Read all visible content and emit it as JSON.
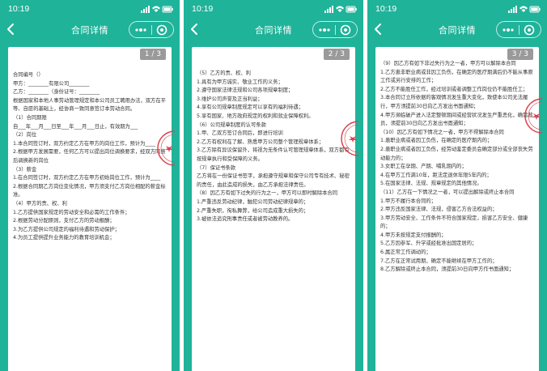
{
  "status": {
    "time": "10:19"
  },
  "nav": {
    "title": "合同详情"
  },
  "pages": [
    {
      "pager": "1 / 3",
      "lines": [
        "合同编号（）",
        "甲方：________有限公司________",
        "乙方：________（身份证号：________",
        "根据国家和本地人事劳动管理规定和本公司员工聘用办法，双方在平等、自愿的基础上，经协商一致同意签订本劳动合同。",
        "（1）合同期限",
        "自___年___月___日至___年___月___日止，有效期为___",
        "（2）岗位",
        "1.本合同签订时，双方约定乙方在甲方的岗位工作，预计为____",
        "2.根据甲方发展需要，任何乙方可以提出岗位调换要求，经双方同意后调换新的岗位",
        "（3）薪金",
        "1.在合同签订时，双方约定乙方在甲方初始岗位工作，预计为____",
        "2.根据合同期乙方岗位变化情况，甲方须支付乙方岗位相配的薪金标准。",
        "（4）甲方的责、权、利",
        "1.乙方提供国家规定的劳动安全和必需的工作条件；",
        "2.根据劳动分配原则，支付乙方的劳动报酬；",
        "3.为乙方提供公司规定的福利待遇和劳动保护；",
        "4.为员工提供提升业务能力的教育培训机会；"
      ]
    },
    {
      "pager": "2 / 3",
      "lines": [
        "（5）乙方的责、权、利",
        "1.具有为甲方诚实、敬业工作的义务；",
        "2.遵守国家法律法规和公司各项规章制度；",
        "3.维护公司声誉及正当利益；",
        "4.享有公司规章制度规定可以享有的福利待遇；",
        "5.享有国家、地方政府规定的权利和就业保障权利。",
        "（6）公司规章制度的认可条款",
        "1.甲、乙双方签订合同后，即进行培训",
        "2.乙方有权利在了解、熟悉甲方公司整个管理规章体系；",
        "3.乙方除有异议保留外，将视为无条件认可管理规章体系，双方都有按规章执行和受保障的义务。",
        "（7）保证书条款",
        "乙方将在一份保证书签字，承担遵守规章和保守公司专有技术、秘密的责任，由此造成的损失，由乙方承担法律责任。",
        "（8）因乙方有如下过失的行为之一，甲方可以即时解除本合同",
        "1.严重违反劳动纪律，触犯公司劳动纪律规章的；",
        "2.严重失职，徇私舞弊，给公司造成重大损失的；",
        "3.被依法追究刑事责任或者被劳动教养的。"
      ]
    },
    {
      "pager": "3 / 3",
      "lines": [
        "（9）因乙方有如下非过失行为之一者，甲方可以解除本合同",
        "1.乙方患非职业病或非因工负伤，在确定的医疗期满后仍不能从事原工作或另行安排的工作；",
        "2.乙方不能胜任工作，经过培训或者调整工作岗位仍不能胜任工；",
        "3.本合同订立所依据的客观情况发生重大变化，致使本公司无法履行，甲方须提前30日向乙方发出书面通知；",
        "4.甲方濒临破产进入法定整顿期间或经营状况发生严重恶化，确需裁员，须提前30日向乙方发出书面通知；",
        "（10）因乙方有如下情况之一者，甲方不得解除本合同",
        "1.患职业病或者因工负伤，在确定的医疗期内的；",
        "2.患职业病或者因工负伤，经劳动鉴定委员会确定部分或全部丧失劳动能力的；",
        "3.女职工在孕期、产期、哺乳期内的；",
        "4.在甲方工作满10年，距法定退休年限5年内的；",
        "5.在国家法律、法规、规章规定的其他情况。",
        "（11）乙方在一下情况之一者，可以提出解除或终止本合同",
        "1.甲方不履行本合同的；",
        "2.甲方违反国家法律、法规，侵害乙方合法权益的；",
        "3.甲方劳动安全、工作条件不符合国家规定，损害乙方安全、健康的；",
        "4.甲方未按规定支付报酬的；",
        "5.乙方因参军、升学或经批准出国定居的；",
        "6.属正常工作调动的；",
        "7.乙方在正常试用期，确定不能继续在甲方工作的；",
        "8.乙方解除或终止本合同，须提前30日向甲方作书面通知；"
      ]
    }
  ],
  "colors": {
    "nav_bg": "#1fb39a",
    "paper": "#ffffff",
    "stamp": "#d9434f",
    "pager_bg": "#9a9a9a"
  },
  "icons": [
    "back-arrow-icon",
    "more-dots-icon",
    "target-icon",
    "signal-icon",
    "wifi-icon",
    "battery-icon",
    "stamp-seal"
  ]
}
